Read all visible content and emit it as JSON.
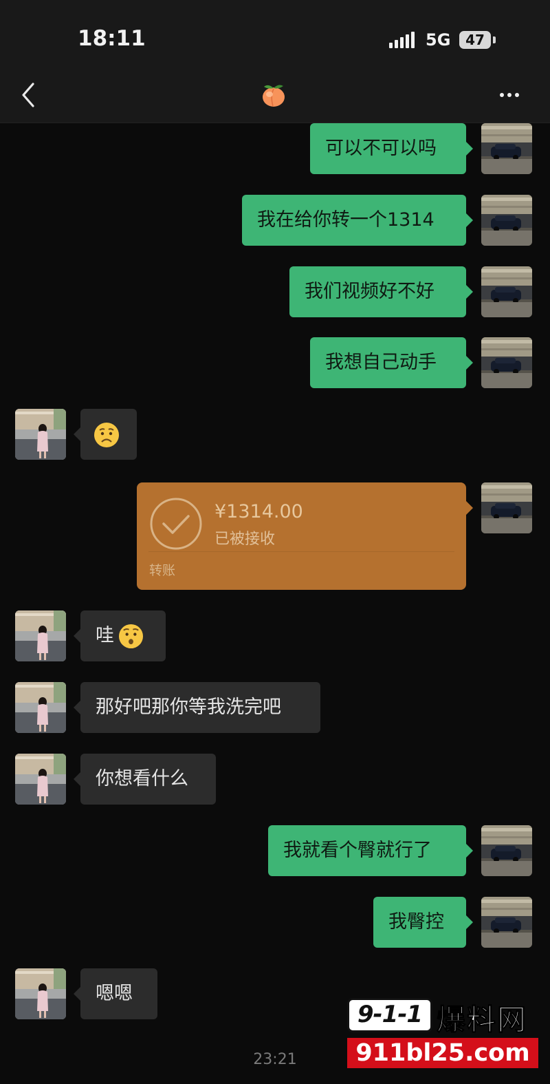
{
  "status_bar": {
    "time": "18:11",
    "network": "5G",
    "battery": "47"
  },
  "header": {
    "title_icon": "peach-emoji",
    "back_icon": "chevron-left-icon",
    "more_icon": "more-dots-icon"
  },
  "messages": [
    {
      "side": "out",
      "text": "可以不可以吗"
    },
    {
      "side": "out",
      "text": "我在给你转一个1314"
    },
    {
      "side": "out",
      "text": "我们视频好不好"
    },
    {
      "side": "out",
      "text": "我想自己动手"
    },
    {
      "side": "in",
      "text": "",
      "emoji": "worried-face-emoji"
    },
    {
      "side": "out",
      "type": "transfer"
    },
    {
      "side": "in",
      "text": "哇",
      "emoji": "hushed-face-emoji"
    },
    {
      "side": "in",
      "text": "那好吧那你等我洗完吧"
    },
    {
      "side": "in",
      "text": "你想看什么"
    },
    {
      "side": "out",
      "text": "我就看个臀就行了"
    },
    {
      "side": "out",
      "text": "我臀控"
    },
    {
      "side": "in",
      "text": "嗯嗯"
    }
  ],
  "transfer": {
    "amount": "¥1314.00",
    "status": "已被接收",
    "label": "转账"
  },
  "timestamp": "23:21",
  "watermark": {
    "logo": "9-1-1",
    "name": "爆料网",
    "url": "911bl25.com"
  },
  "colors": {
    "background": "#0b0b0b",
    "outgoing_bubble": "#3eb575",
    "incoming_bubble": "#2c2c2c",
    "transfer_card": "#b5712f"
  }
}
